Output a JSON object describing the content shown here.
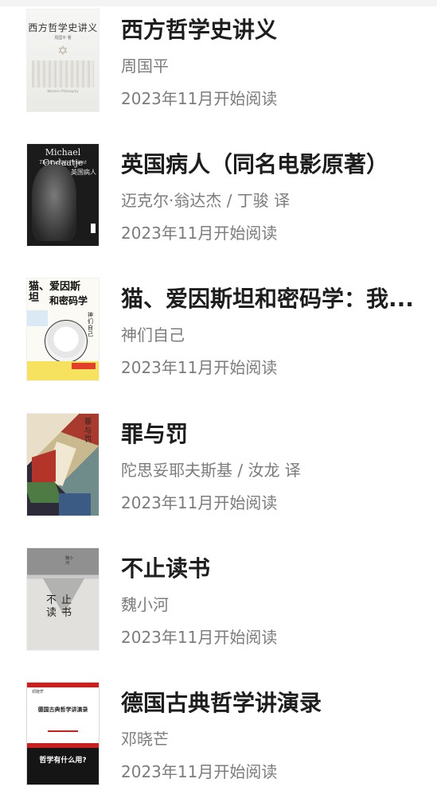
{
  "books": [
    {
      "title": "西方哲学史讲义",
      "author": "周国平",
      "date": "2023年11月开始阅读",
      "cover": {
        "text": "西方哲学史讲义",
        "author": "周国平 著",
        "subtitle": "Western Philosophy",
        "publisher": ""
      }
    },
    {
      "title": "英国病人（同名电影原著）",
      "author": "迈克尔·翁达杰 / 丁骏 译",
      "date": "2023年11月开始阅读",
      "cover": {
        "text": "Michael Ondaatje",
        "subtitle": "The English Patient",
        "cn_title": "英国病人"
      }
    },
    {
      "title": "猫、爱因斯坦和密码学：我...",
      "author": "神们自己",
      "date": "2023年11月开始阅读",
      "cover": {
        "text": "猫、爱因斯坦",
        "text2": "和密码学",
        "side": "神们自己"
      }
    },
    {
      "title": "罪与罚",
      "author": "陀思妥耶夫斯基 / 汝龙 译",
      "date": "2023年11月开始阅读",
      "cover": {
        "text": "罪与罚"
      }
    },
    {
      "title": "不止读书",
      "author": "魏小河",
      "date": "2023年11月开始阅读",
      "cover": {
        "author": "魏小河",
        "text": "不止读书"
      }
    },
    {
      "title": "德国古典哲学讲演录",
      "author": "邓晓芒",
      "date": "2023年11月开始阅读",
      "cover": {
        "author": "邓晓芒",
        "text": "德国古典哲学讲演录",
        "question": "哲学有什么用?"
      }
    }
  ]
}
